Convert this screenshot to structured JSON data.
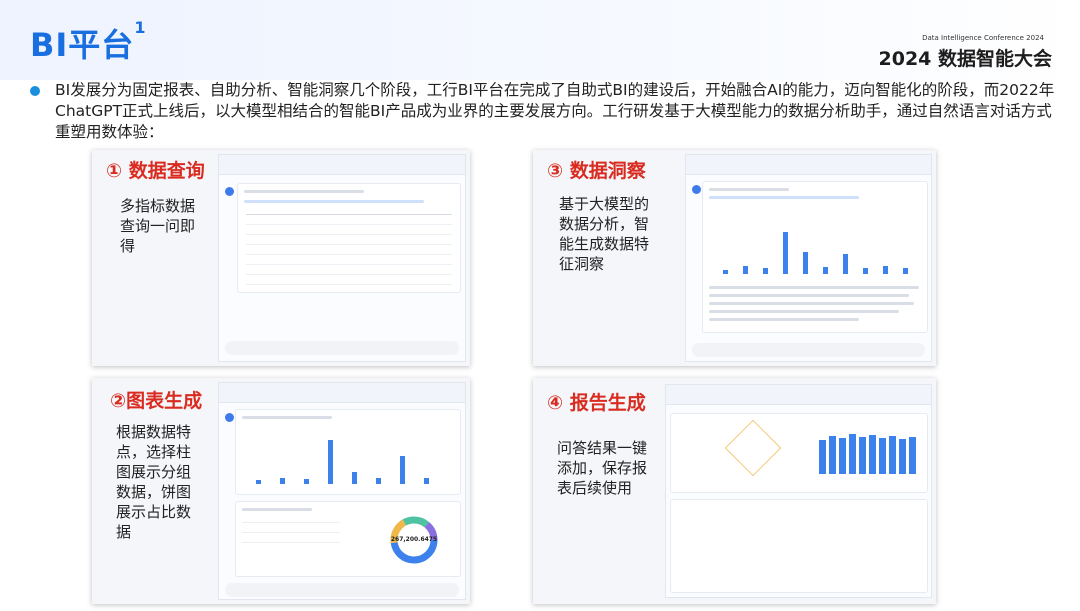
{
  "title": {
    "main": "BI平台",
    "sup": "1"
  },
  "conference": {
    "subtitle": "Data Intelligence Conference 2024",
    "name": "2024 数据智能大会"
  },
  "bullet": "BI发展分为固定报表、自助分析、智能洞察几个阶段，工行BI平台在完成了自助式BI的建设后，开始融合AI的能力，迈向智能化的阶段，而2022年ChatGPT正式上线后，以大模型相结合的智能BI产品成为业界的主要发展方向。工行研发基于大模型能力的数据分析助手，通过自然语言对话方式重塑用数体验：",
  "panels": [
    {
      "heading": "① 数据查询",
      "desc": "多指标数据查询一问即得"
    },
    {
      "heading": "③ 数据洞察",
      "desc": "基于大模型的数据分析，智能生成数据特征洞察"
    },
    {
      "heading": "②图表生成",
      "desc": "根据数据特点，选择柱图展示分组数据，饼图展示占比数据"
    },
    {
      "heading": "④ 报告生成",
      "desc": "问答结果一键添加，保存报表后续使用"
    }
  ],
  "mock_values": {
    "donut_center": "267,200.6475"
  },
  "colors": {
    "accent": "#1a6fe0",
    "heading_red": "#d92b1f",
    "bar_blue": "#3d82ec"
  }
}
